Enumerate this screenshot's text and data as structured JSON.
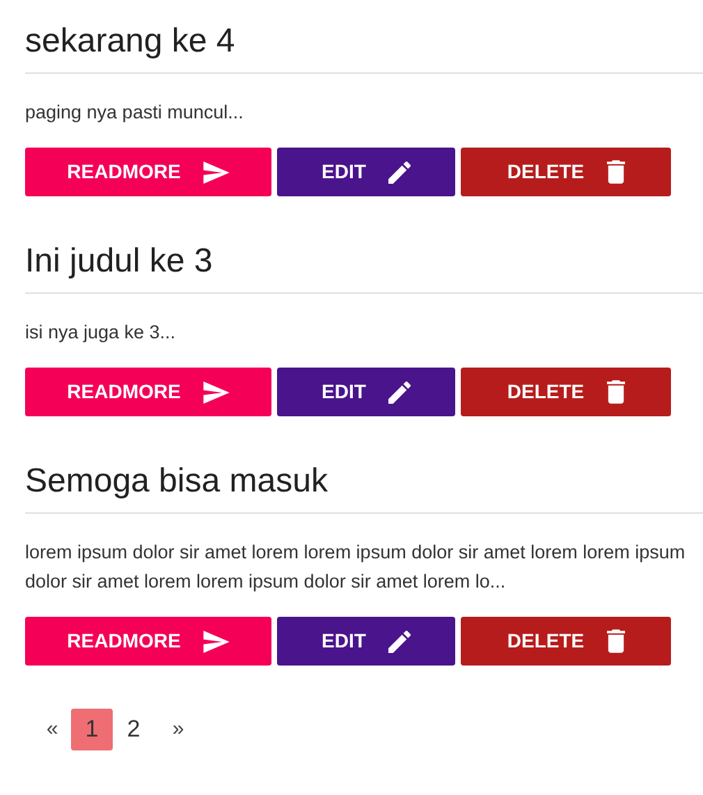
{
  "posts": [
    {
      "title": "sekarang ke 4",
      "excerpt": "paging nya pasti muncul...",
      "buttons": [
        {
          "kind": "readmore",
          "label": "READMORE"
        },
        {
          "kind": "edit",
          "label": "EDIT"
        },
        {
          "kind": "delete",
          "label": "DELETE"
        }
      ]
    },
    {
      "title": "Ini judul ke 3",
      "excerpt": "isi nya juga ke 3...",
      "buttons": [
        {
          "kind": "readmore",
          "label": "READMORE"
        },
        {
          "kind": "edit",
          "label": "EDIT"
        },
        {
          "kind": "delete",
          "label": "DELETE"
        }
      ]
    },
    {
      "title": "Semoga bisa masuk",
      "excerpt": "lorem ipsum dolor sir amet lorem lorem ipsum dolor sir amet lorem lorem ipsum dolor sir amet lorem lorem ipsum dolor sir amet lorem lo...",
      "buttons": [
        {
          "kind": "readmore",
          "label": "READMORE"
        },
        {
          "kind": "edit",
          "label": "EDIT"
        },
        {
          "kind": "delete",
          "label": "DELETE"
        }
      ]
    }
  ],
  "pagination": {
    "prev": "«",
    "pages": [
      {
        "label": "1",
        "selected": true
      },
      {
        "label": "2",
        "selected": false
      }
    ],
    "next": "»"
  }
}
